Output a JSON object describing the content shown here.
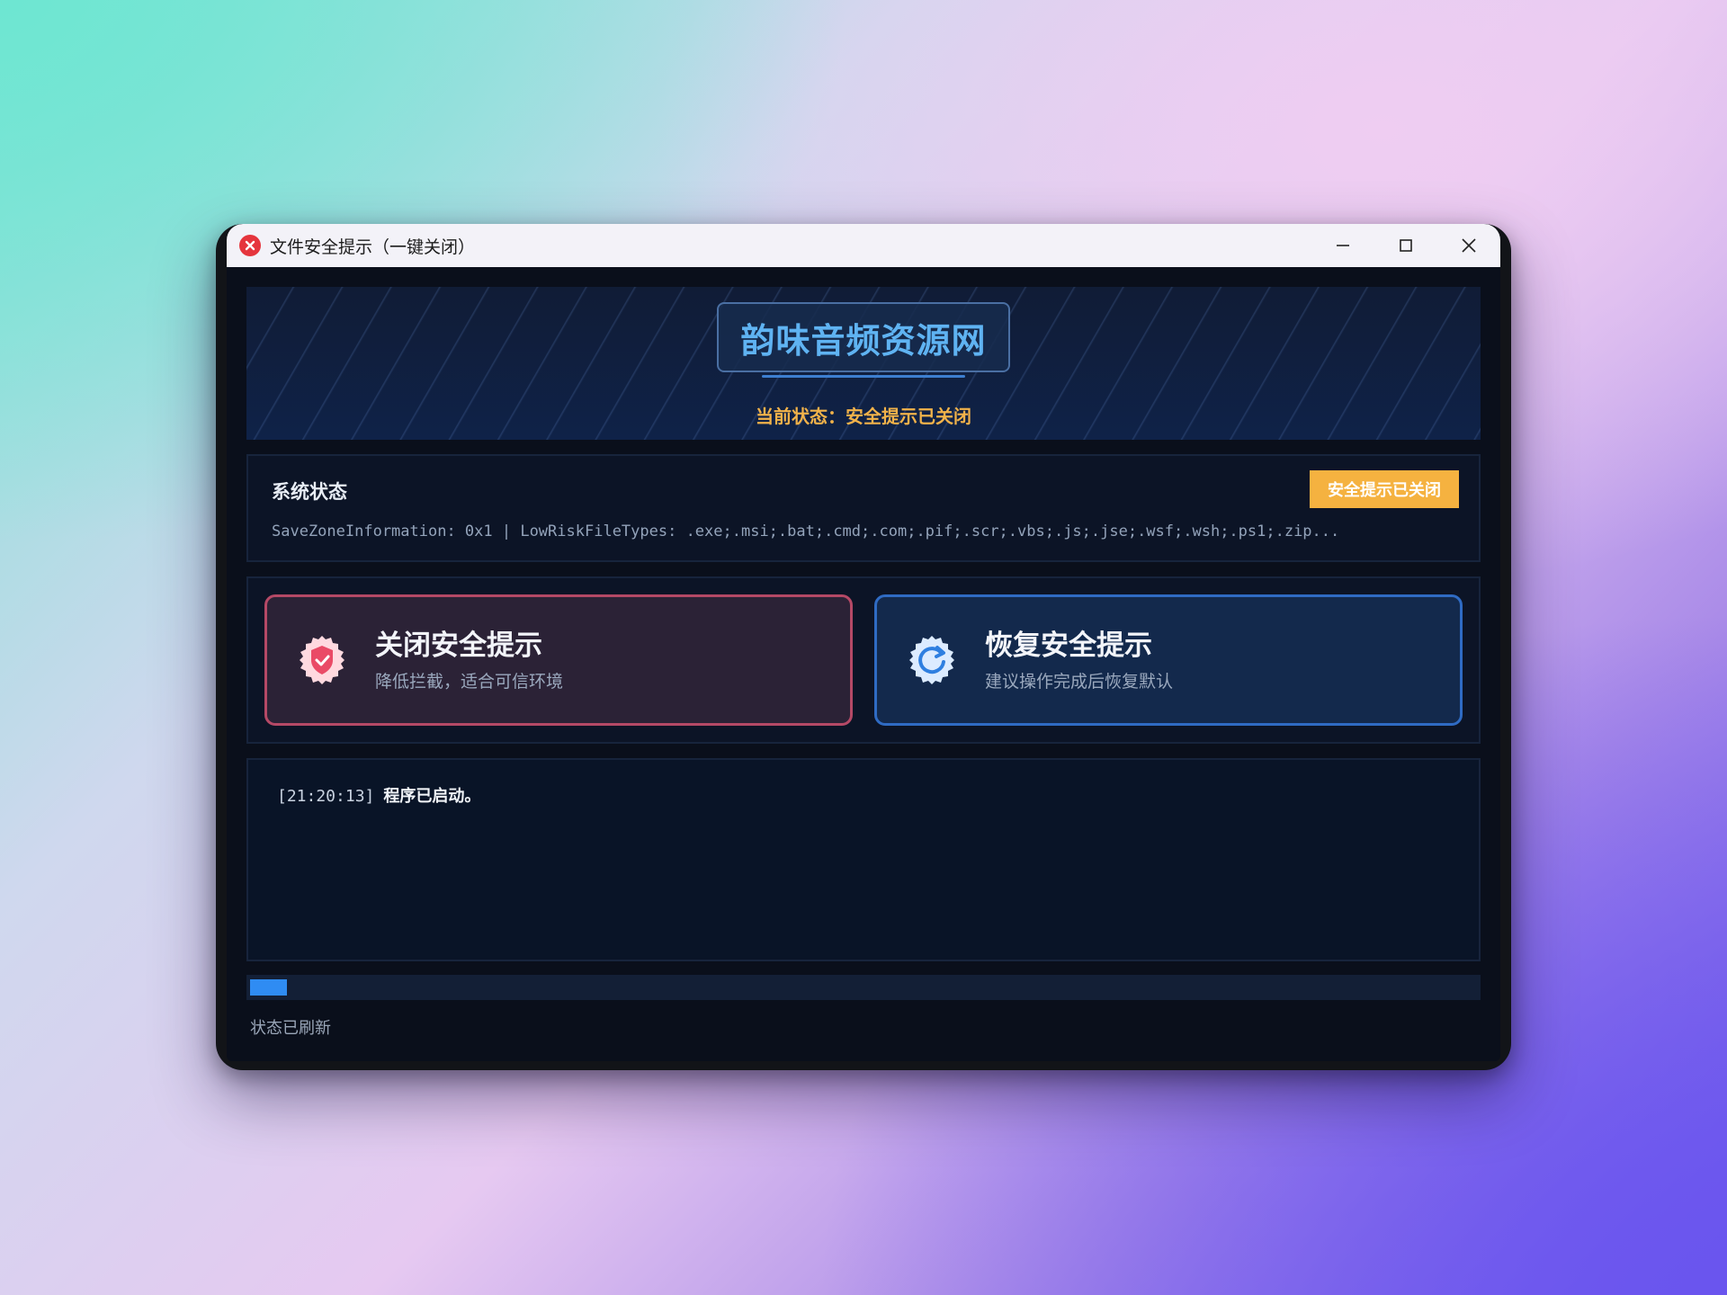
{
  "window": {
    "title": "文件安全提示（一键关闭）",
    "controls": {
      "minimize": "minimize",
      "maximize": "maximize",
      "close": "close"
    }
  },
  "header": {
    "brand": "韵味音频资源网",
    "current_status": "当前状态：安全提示已关闭"
  },
  "system_status": {
    "title": "系统状态",
    "badge": "安全提示已关闭",
    "detail": "SaveZoneInformation: 0x1 | LowRiskFileTypes: .exe;.msi;.bat;.cmd;.com;.pif;.scr;.vbs;.js;.jse;.wsf;.wsh;.ps1;.zip..."
  },
  "actions": {
    "disable": {
      "title": "关闭安全提示",
      "subtitle": "降低拦截，适合可信环境",
      "icon": "shield-check-icon"
    },
    "restore": {
      "title": "恢复安全提示",
      "subtitle": "建议操作完成后恢复默认",
      "icon": "refresh-icon"
    }
  },
  "log": {
    "entries": [
      {
        "time": "[21:20:13]",
        "message": "程序已启动。"
      }
    ]
  },
  "progress": {
    "value": 0.03
  },
  "footer": {
    "status": "状态已刷新"
  },
  "colors": {
    "accent_orange": "#f5b240",
    "brand_blue": "#5fb3f2",
    "danger_border": "#b54966",
    "info_border": "#2f6bc3",
    "progress": "#2f8cf3"
  }
}
